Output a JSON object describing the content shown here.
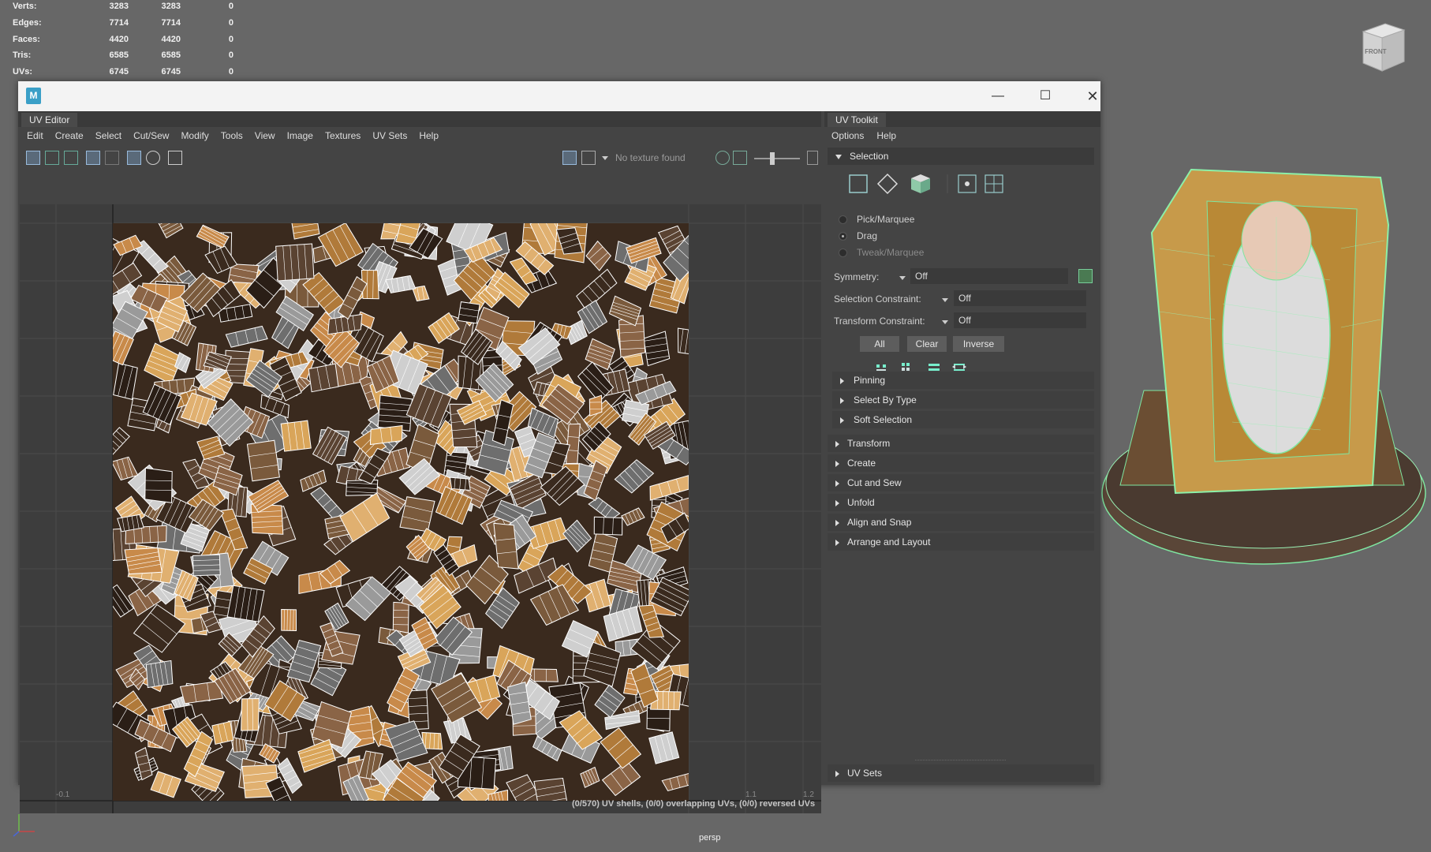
{
  "hud": {
    "rows": [
      {
        "label": "Verts:",
        "v1": "3283",
        "v2": "3283",
        "v3": "0"
      },
      {
        "label": "Edges:",
        "v1": "7714",
        "v2": "7714",
        "v3": "0"
      },
      {
        "label": "Faces:",
        "v1": "4420",
        "v2": "4420",
        "v3": "0"
      },
      {
        "label": "Tris:",
        "v1": "6585",
        "v2": "6585",
        "v3": "0"
      },
      {
        "label": "UVs:",
        "v1": "6745",
        "v2": "6745",
        "v3": "0"
      }
    ]
  },
  "viewport": {
    "camera_label": "persp",
    "viewcube_label": "FRONT"
  },
  "window": {
    "logo": "M",
    "uv_editor": {
      "tab": "UV Editor",
      "menu": [
        "Edit",
        "Create",
        "Select",
        "Cut/Sew",
        "Modify",
        "Tools",
        "View",
        "Image",
        "Textures",
        "UV Sets",
        "Help"
      ],
      "texture_status": "No texture found",
      "axis_labels": {
        "left": "-0.1",
        "right_a": "1.1",
        "right_b": "1.2"
      },
      "status": "(0/570) UV shells, (0/0) overlapping UVs, (0/0) reversed UVs"
    },
    "toolkit": {
      "tab": "UV Toolkit",
      "menu": [
        "Options",
        "Help"
      ],
      "selection": {
        "title": "Selection",
        "modes": [
          {
            "label": "Pick/Marquee",
            "checked": false,
            "disabled": false
          },
          {
            "label": "Drag",
            "checked": true,
            "disabled": false
          },
          {
            "label": "Tweak/Marquee",
            "checked": false,
            "disabled": true
          }
        ],
        "symmetry_label": "Symmetry:",
        "symmetry_value": "Off",
        "sel_constraint_label": "Selection Constraint:",
        "sel_constraint_value": "Off",
        "xform_constraint_label": "Transform Constraint:",
        "xform_constraint_value": "Off",
        "buttons": [
          "All",
          "Clear",
          "Inverse"
        ],
        "subsections": [
          "Pinning",
          "Select By Type",
          "Soft Selection"
        ]
      },
      "sections": [
        "Transform",
        "Create",
        "Cut and Sew",
        "Unfold",
        "Align and Snap",
        "Arrange and Layout"
      ],
      "footer_section": "UV Sets"
    }
  }
}
